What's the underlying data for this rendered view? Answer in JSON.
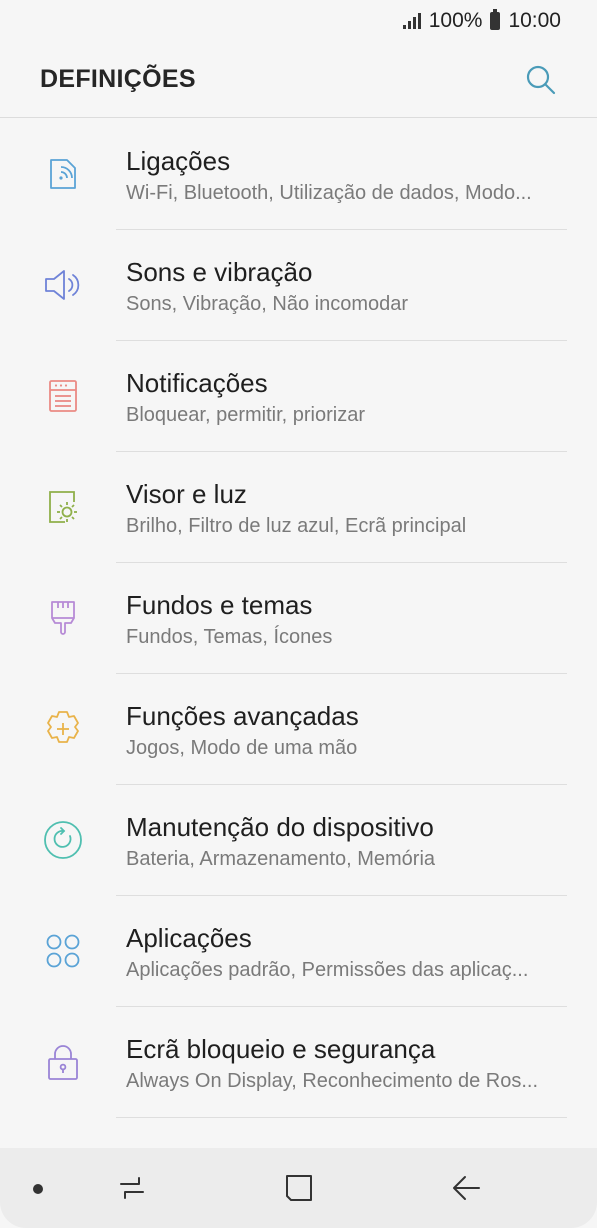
{
  "status_bar": {
    "battery": "100%",
    "time": "10:00"
  },
  "header": {
    "title": "DEFINIÇÕES"
  },
  "items": [
    {
      "title": "Ligações",
      "subtitle": "Wi-Fi, Bluetooth, Utilização de dados, Modo...",
      "icon": "connections-icon",
      "color": "#5aa3d6"
    },
    {
      "title": "Sons e vibração",
      "subtitle": "Sons, Vibração, Não incomodar",
      "icon": "speaker-icon",
      "color": "#6f83d8"
    },
    {
      "title": "Notificações",
      "subtitle": "Bloquear, permitir, priorizar",
      "icon": "notifications-icon",
      "color": "#ea8a84"
    },
    {
      "title": "Visor e luz",
      "subtitle": "Brilho, Filtro de luz azul, Ecrã principal",
      "icon": "display-icon",
      "color": "#8fb04a"
    },
    {
      "title": "Fundos e temas",
      "subtitle": "Fundos, Temas, Ícones",
      "icon": "brush-icon",
      "color": "#b78bd6"
    },
    {
      "title": "Funções avançadas",
      "subtitle": "Jogos, Modo de uma mão",
      "icon": "gear-plus-icon",
      "color": "#e9b34a"
    },
    {
      "title": "Manutenção do dispositivo",
      "subtitle": "Bateria, Armazenamento, Memória",
      "icon": "maintenance-icon",
      "color": "#4fbfb0"
    },
    {
      "title": "Aplicações",
      "subtitle": "Aplicações padrão, Permissões das aplicaç...",
      "icon": "apps-icon",
      "color": "#5aa3d6"
    },
    {
      "title": "Ecrã bloqueio e segurança",
      "subtitle": "Always On Display, Reconhecimento de Ros...",
      "icon": "lock-icon",
      "color": "#9a84d6"
    }
  ],
  "colors": {
    "search": "#4a9bb8",
    "nav_icons": "#333333"
  }
}
